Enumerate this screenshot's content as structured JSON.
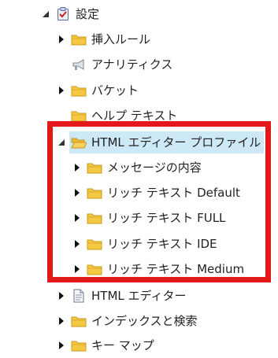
{
  "tree": {
    "root": {
      "label": "設定",
      "icon": "settings-checklist-icon",
      "expanded": true
    },
    "items": [
      {
        "label": "挿入ルール",
        "icon": "folder-icon",
        "toggle": "collapsed"
      },
      {
        "label": "アナリティクス",
        "icon": "megaphone-icon",
        "toggle": "none"
      },
      {
        "label": "バケット",
        "icon": "folder-icon",
        "toggle": "collapsed"
      },
      {
        "label": "ヘルプ テキスト",
        "icon": "folder-icon",
        "toggle": "none"
      },
      {
        "label": "HTML エディター プロファイル",
        "icon": "folder-open-icon",
        "toggle": "expanded",
        "selected": true
      },
      {
        "label": "メッセージの内容",
        "icon": "folder-icon",
        "toggle": "collapsed"
      },
      {
        "label": "リッチ テキスト Default",
        "icon": "folder-icon",
        "toggle": "collapsed"
      },
      {
        "label": "リッチ テキスト FULL",
        "icon": "folder-icon",
        "toggle": "collapsed"
      },
      {
        "label": "リッチ テキスト IDE",
        "icon": "folder-icon",
        "toggle": "collapsed"
      },
      {
        "label": "リッチ テキスト Medium",
        "icon": "folder-icon",
        "toggle": "collapsed"
      },
      {
        "label": "HTML エディター",
        "icon": "document-icon",
        "toggle": "collapsed"
      },
      {
        "label": "インデックスと検索",
        "icon": "folder-icon",
        "toggle": "collapsed"
      },
      {
        "label": "キー マップ",
        "icon": "folder-icon",
        "toggle": "collapsed"
      }
    ]
  },
  "colors": {
    "selection": "#cde8f6",
    "highlight_border": "#e31818",
    "folder": "#f5c844"
  }
}
